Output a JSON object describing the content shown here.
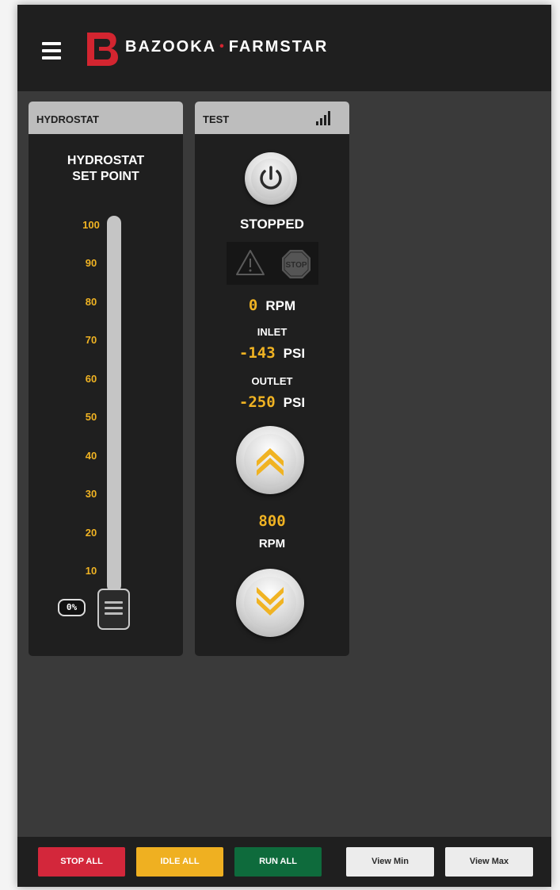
{
  "header": {
    "brand_left": "BAZOOKA",
    "brand_separator": "•",
    "brand_right": "FARMSTAR"
  },
  "hydrostat_card": {
    "title": "HYDROSTAT",
    "setpoint_line1": "HYDROSTAT",
    "setpoint_line2": "SET POINT",
    "scale": [
      "100",
      "90",
      "80",
      "70",
      "60",
      "50",
      "40",
      "30",
      "20",
      "10"
    ],
    "value_label": "0%",
    "value_fraction": 0
  },
  "test_card": {
    "title": "TEST",
    "status": "STOPPED",
    "stop_sign_text": "STOP",
    "rpm_value": "0",
    "rpm_unit": "RPM",
    "inlet_label": "INLET",
    "inlet_value": "-143",
    "inlet_unit": "PSI",
    "outlet_label": "OUTLET",
    "outlet_value": "-250",
    "outlet_unit": "PSI",
    "target_rpm_value": "800",
    "target_rpm_unit": "RPM"
  },
  "bottom_bar": {
    "stop_all": "STOP ALL",
    "idle_all": "IDLE ALL",
    "run_all": "RUN ALL",
    "view_min": "View Min",
    "view_max": "View Max"
  },
  "colors": {
    "brand_red": "#d32530",
    "accent_amber": "#f0b323",
    "stop_red": "#d3273b",
    "idle_amber": "#efb021",
    "run_green": "#0e6b3c",
    "panel": "#1f1f1f",
    "background": "#3a3a3a"
  },
  "icons": [
    "menu-icon",
    "logo-icon",
    "signal-icon",
    "power-icon",
    "warning-icon",
    "stop-sign-icon",
    "chevron-up-icon",
    "chevron-down-icon"
  ]
}
